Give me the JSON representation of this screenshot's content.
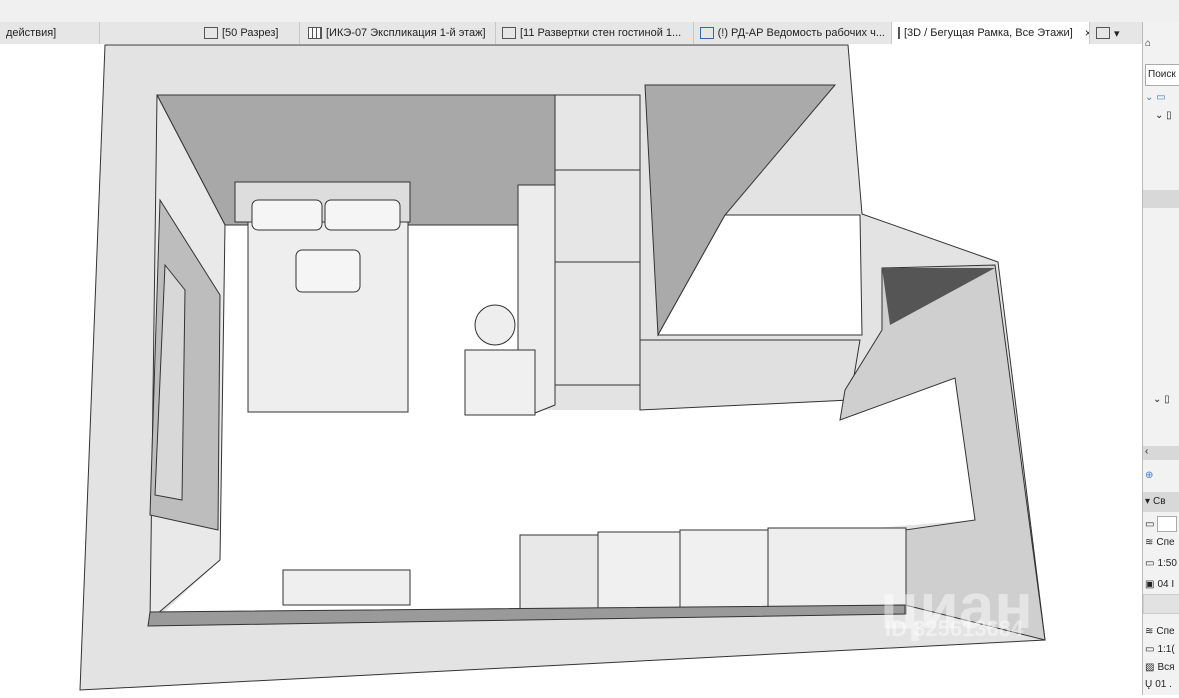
{
  "tabs": [
    {
      "label": "действия]",
      "icon": "none"
    },
    {
      "label": "[50 Разрез]",
      "icon": "section-icon"
    },
    {
      "label": "[ИКЭ-07 Экспликация 1-й этаж]",
      "icon": "schedule-icon"
    },
    {
      "label": "[11 Развертки стен гостиной  1...",
      "icon": "layout-icon"
    },
    {
      "label": "(!) РД-АР Ведомость рабочих ч...",
      "icon": "layout-icon"
    },
    {
      "label": "[3D / Бегущая Рамка, Все Этажи]",
      "icon": "3d-icon",
      "active": true
    }
  ],
  "tab_close": "×",
  "tab_menu": "▾",
  "panel": {
    "search_placeholder": "Поиск",
    "rows1": [
      "Св",
      "Спе",
      "1:50",
      "04 I"
    ],
    "rows2": [
      "Спе",
      "1:1(",
      "Вся",
      "01 ."
    ]
  },
  "watermark": {
    "brand": "циан",
    "id": "ID 325613684"
  },
  "colors": {
    "wall_top": "#a9a9a9",
    "slab": "#e4e4e4",
    "floor": "#ffffff"
  }
}
